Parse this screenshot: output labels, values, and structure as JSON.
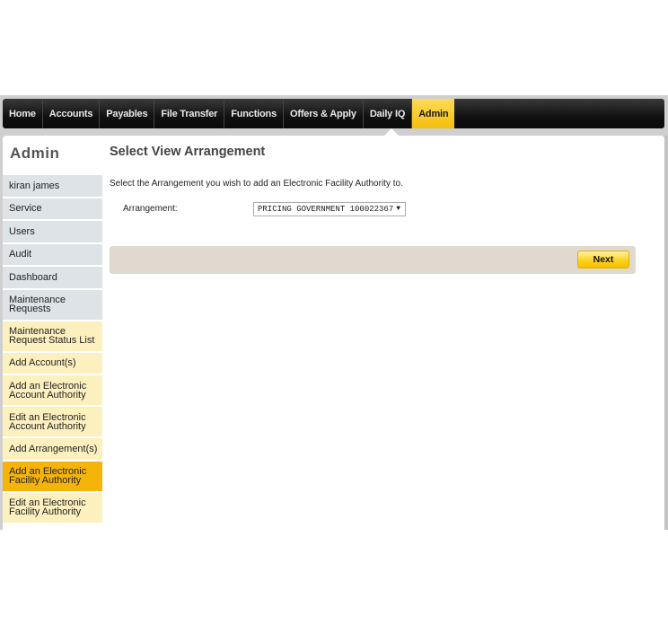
{
  "nav": {
    "items": [
      {
        "label": "Home"
      },
      {
        "label": "Accounts"
      },
      {
        "label": "Payables"
      },
      {
        "label": "File Transfer"
      },
      {
        "label": "Functions"
      },
      {
        "label": "Offers & Apply"
      },
      {
        "label": "Daily IQ"
      },
      {
        "label": "Admin",
        "active": true
      }
    ]
  },
  "sidebar": {
    "title": "Admin",
    "items": [
      {
        "label": "kiran james",
        "style": "gray"
      },
      {
        "label": "Service",
        "style": "gray"
      },
      {
        "label": "Users",
        "style": "gray"
      },
      {
        "label": "Audit",
        "style": "gray"
      },
      {
        "label": "Dashboard",
        "style": "gray"
      },
      {
        "label": "Maintenance Requests",
        "style": "gray"
      },
      {
        "label": "Maintenance Request Status List",
        "style": "yellow"
      },
      {
        "label": "Add Account(s)",
        "style": "yellow"
      },
      {
        "label": "Add an Electronic Account Authority",
        "style": "yellow"
      },
      {
        "label": "Edit an Electronic Account Authority",
        "style": "yellow"
      },
      {
        "label": "Add Arrangement(s)",
        "style": "yellow"
      },
      {
        "label": "Add an Electronic Facility Authority",
        "style": "active"
      },
      {
        "label": "Edit an Electronic Facility Authority",
        "style": "yellow"
      }
    ]
  },
  "main": {
    "title": "Select View Arrangement",
    "description": "Select the Arrangement you wish to add an Electronic Facility Authority to.",
    "arrangement_label": "Arrangement:",
    "arrangement_value": "PRICING GOVERNMENT 100022367",
    "dropdown_arrow": "▼",
    "next_label": "Next"
  },
  "colors": {
    "accent": "#f6b40a",
    "nav_bg": "#111111",
    "action_bar": "#e0d9d0"
  }
}
